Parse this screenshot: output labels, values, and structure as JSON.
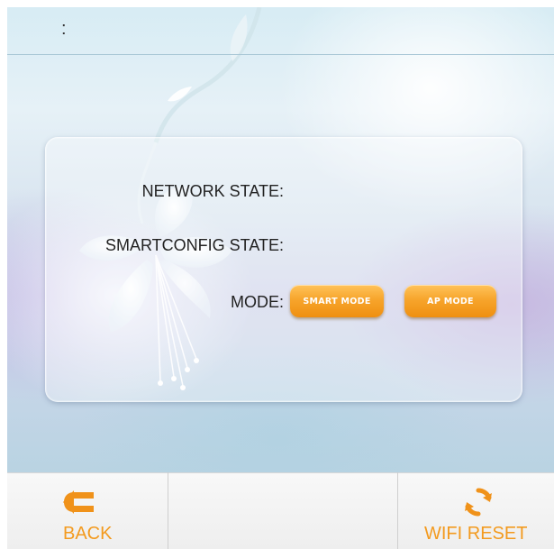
{
  "top_bar": {
    "text": ":"
  },
  "panel": {
    "network_state_label": "NETWORK STATE:",
    "smartconfig_state_label": "SMARTCONFIG STATE:",
    "mode_label": "MODE:",
    "smart_mode_button": "SMART MODE",
    "ap_mode_button": "AP MODE"
  },
  "toolbar": {
    "back_label": "BACK",
    "wifi_reset_label": "WIFI RESET"
  },
  "icons": {
    "back": "back-arrow-icon",
    "wifi_reset": "refresh-icon"
  },
  "colors": {
    "accent_orange": "#f39a1e",
    "button_orange": "#f7a52c"
  }
}
